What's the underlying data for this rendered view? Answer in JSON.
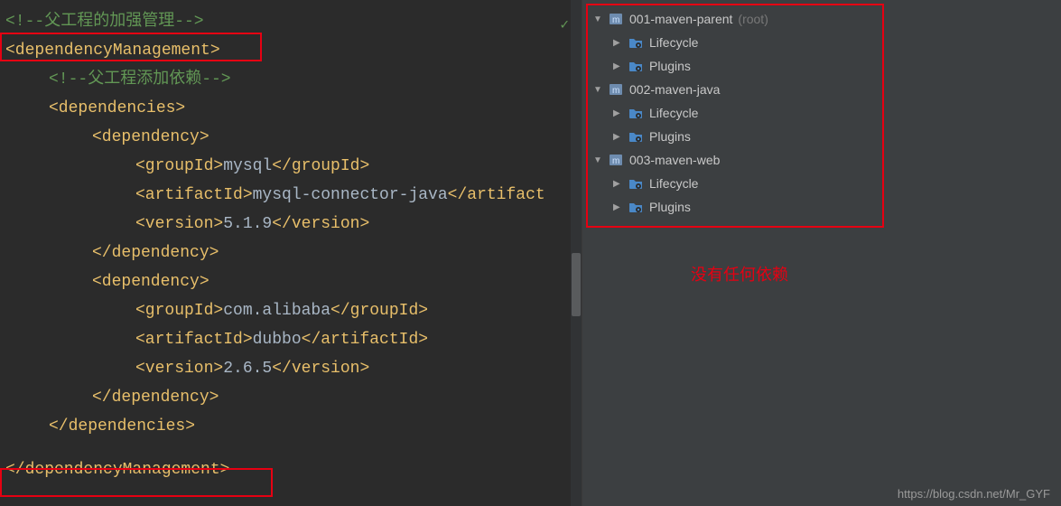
{
  "editor": {
    "comment_parent": "<!--父工程的加强管理-->",
    "open_depMgmt": "<dependencyManagement>",
    "comment_add": "<!--父工程添加依赖-->",
    "open_deps": "<dependencies>",
    "open_dep": "<dependency>",
    "close_dep": "</dependency>",
    "dep1_group": "<groupId>mysql</groupId>",
    "dep1_artifact": "<artifactId>mysql-connector-java</artifact",
    "dep1_version": "<version>5.1.9</version>",
    "dep2_group": "<groupId>com.alibaba</groupId>",
    "dep2_artifact": "<artifactId>dubbo</artifactId>",
    "dep2_version": "<version>2.6.5</version>",
    "close_deps": "</dependencies>",
    "close_depMgmt": "</dependencyManagement>"
  },
  "tree": {
    "p1": {
      "name": "001-maven-parent",
      "suffix": "(root)"
    },
    "p2": {
      "name": "002-maven-java"
    },
    "p3": {
      "name": "003-maven-web"
    },
    "lifecycle": "Lifecycle",
    "plugins": "Plugins"
  },
  "note": "没有任何依赖",
  "watermark": "https://blog.csdn.net/Mr_GYF"
}
